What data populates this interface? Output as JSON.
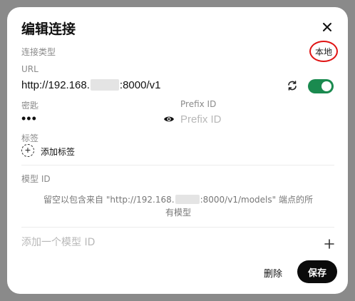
{
  "dialog": {
    "title": "编辑连接",
    "connection_type": {
      "label": "连接类型",
      "value": "本地"
    },
    "url": {
      "label": "URL",
      "value_prefix": "http://192.168.",
      "value_suffix": ":8000/v1",
      "enabled": true
    },
    "key": {
      "label": "密匙",
      "masked_value": "•••"
    },
    "prefix_id": {
      "label": "Prefix ID",
      "placeholder": "Prefix ID"
    },
    "tags": {
      "label": "标签",
      "add_label": "添加标签"
    },
    "model_ids": {
      "label": "模型 ID",
      "empty_note_prefix": "留空以包含来自 \"http://192.168.",
      "empty_note_middle": ":8000/v1/models\" 端点的所",
      "empty_note_line2": "有模型",
      "input_placeholder": "添加一个模型 ID"
    },
    "buttons": {
      "delete": "删除",
      "save": "保存"
    },
    "colors": {
      "toggle_on": "#1a8a4f",
      "save_bg": "#0b0b0b",
      "highlight": "#e01313"
    },
    "icons": [
      "close-icon",
      "refresh-icon",
      "eye-icon",
      "plus-circle-icon",
      "plus-icon"
    ]
  }
}
